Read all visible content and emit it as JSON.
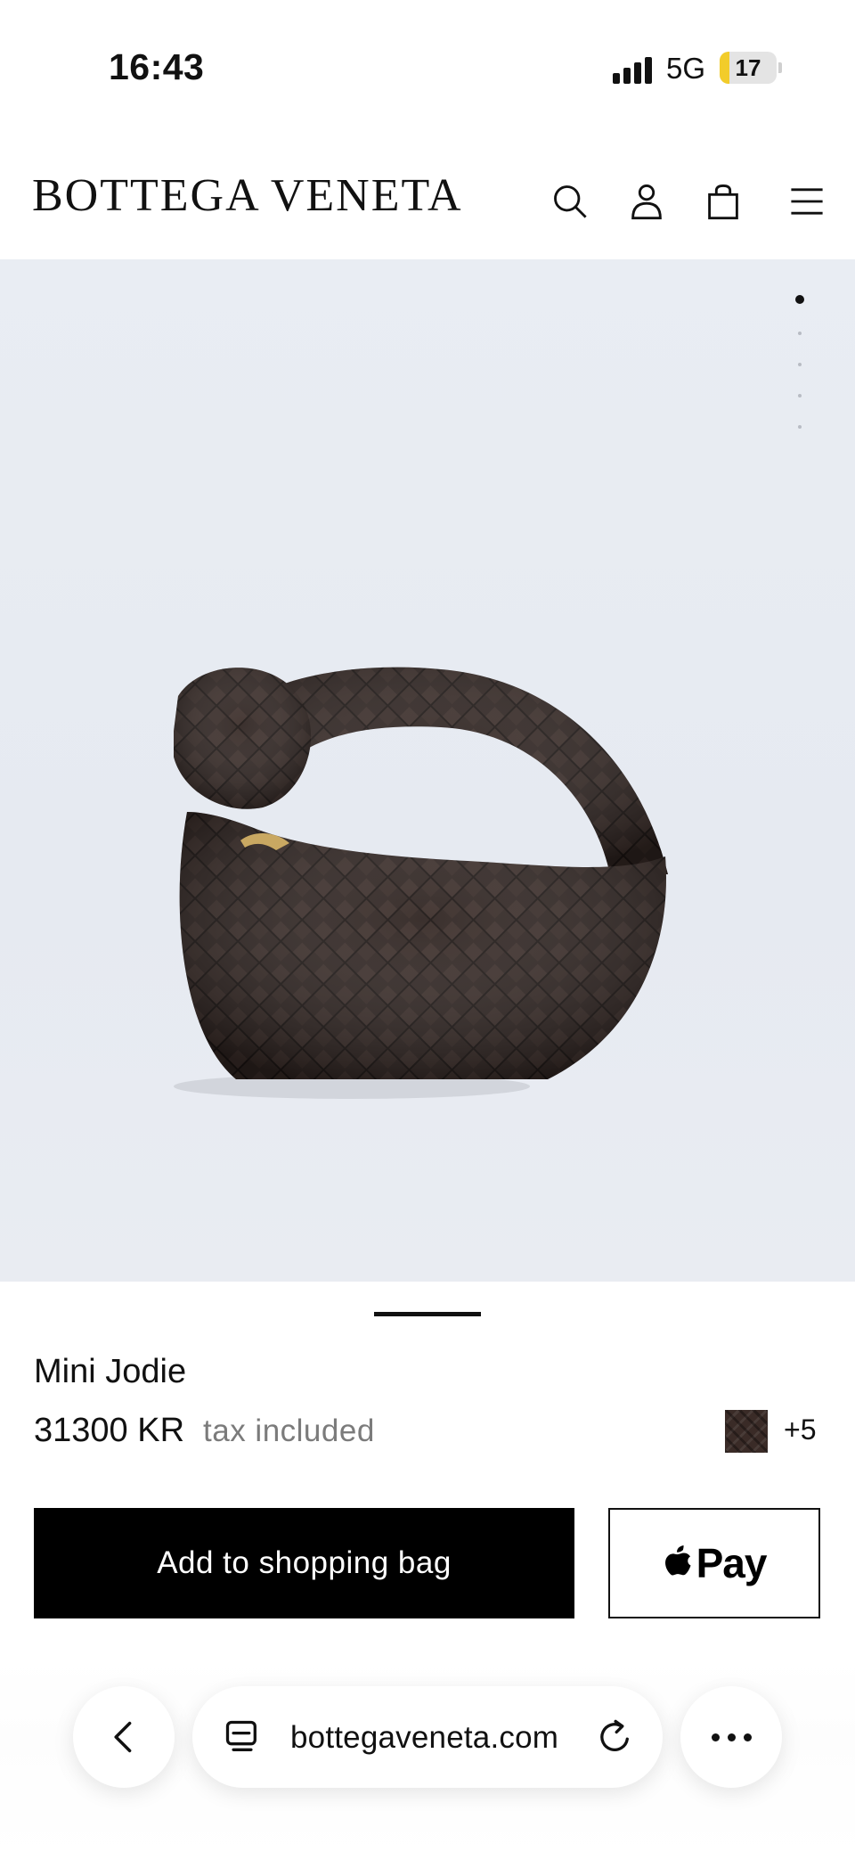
{
  "status_bar": {
    "time": "16:43",
    "network": "5G",
    "battery": "17",
    "battery_level": 0.17
  },
  "header": {
    "brand": "BOTTEGA VENETA",
    "icons": [
      "search-icon",
      "account-icon",
      "shopping-bag-icon",
      "menu-icon"
    ]
  },
  "carousel": {
    "slide_count": 5,
    "active_index": 0
  },
  "product": {
    "name": "Mini Jodie",
    "price": "31300 KR",
    "tax_note": "tax included",
    "more_colors": "+5",
    "swatch_color": "#3a2b27"
  },
  "actions": {
    "add_to_bag": "Add to shopping bag",
    "apple_pay": "Pay"
  },
  "browser": {
    "url": "bottegaveneta.com",
    "icons": [
      "back-icon",
      "tabs-icon",
      "reload-icon",
      "more-icon"
    ]
  }
}
